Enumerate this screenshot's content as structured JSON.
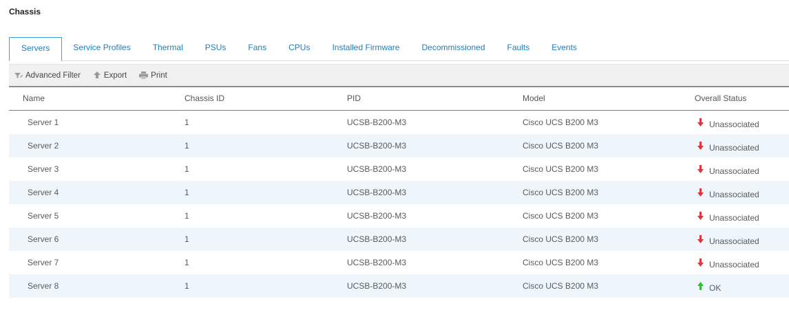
{
  "page": {
    "title": "Chassis"
  },
  "tabs": [
    {
      "label": "Servers",
      "active": true
    },
    {
      "label": "Service Profiles",
      "active": false
    },
    {
      "label": "Thermal",
      "active": false
    },
    {
      "label": "PSUs",
      "active": false
    },
    {
      "label": "Fans",
      "active": false
    },
    {
      "label": "CPUs",
      "active": false
    },
    {
      "label": "Installed Firmware",
      "active": false
    },
    {
      "label": "Decommissioned",
      "active": false
    },
    {
      "label": "Faults",
      "active": false
    },
    {
      "label": "Events",
      "active": false
    }
  ],
  "toolbar": {
    "advanced_filter": {
      "label": "Advanced Filter",
      "icon": "filter-icon"
    },
    "export": {
      "label": "Export",
      "icon": "export-icon"
    },
    "print": {
      "label": "Print",
      "icon": "print-icon"
    }
  },
  "table": {
    "columns": [
      "Name",
      "Chassis ID",
      "PID",
      "Model",
      "Overall Status"
    ],
    "rows": [
      {
        "name": "Server 1",
        "chassis_id": "1",
        "pid": "UCSB-B200-M3",
        "model": "Cisco UCS B200 M3",
        "status": "Unassociated",
        "status_icon": "arrow-down-icon"
      },
      {
        "name": "Server 2",
        "chassis_id": "1",
        "pid": "UCSB-B200-M3",
        "model": "Cisco UCS B200 M3",
        "status": "Unassociated",
        "status_icon": "arrow-down-icon"
      },
      {
        "name": "Server 3",
        "chassis_id": "1",
        "pid": "UCSB-B200-M3",
        "model": "Cisco UCS B200 M3",
        "status": "Unassociated",
        "status_icon": "arrow-down-icon"
      },
      {
        "name": "Server 4",
        "chassis_id": "1",
        "pid": "UCSB-B200-M3",
        "model": "Cisco UCS B200 M3",
        "status": "Unassociated",
        "status_icon": "arrow-down-icon"
      },
      {
        "name": "Server 5",
        "chassis_id": "1",
        "pid": "UCSB-B200-M3",
        "model": "Cisco UCS B200 M3",
        "status": "Unassociated",
        "status_icon": "arrow-down-icon"
      },
      {
        "name": "Server 6",
        "chassis_id": "1",
        "pid": "UCSB-B200-M3",
        "model": "Cisco UCS B200 M3",
        "status": "Unassociated",
        "status_icon": "arrow-down-icon"
      },
      {
        "name": "Server 7",
        "chassis_id": "1",
        "pid": "UCSB-B200-M3",
        "model": "Cisco UCS B200 M3",
        "status": "Unassociated",
        "status_icon": "arrow-down-icon"
      },
      {
        "name": "Server 8",
        "chassis_id": "1",
        "pid": "UCSB-B200-M3",
        "model": "Cisco UCS B200 M3",
        "status": "OK",
        "status_icon": "arrow-up-icon"
      }
    ]
  },
  "colors": {
    "accent": "#1a7fc1",
    "status_down": "#d9363e",
    "status_ok": "#2fbf2f",
    "row_alt": "#eef6fc"
  }
}
